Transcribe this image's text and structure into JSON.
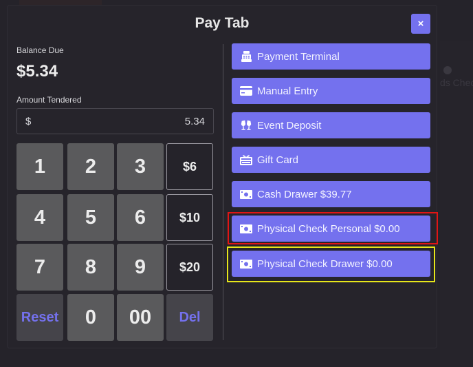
{
  "modal": {
    "title": "Pay Tab",
    "close_label": "×"
  },
  "balance": {
    "label": "Balance Due",
    "value": "$5.34"
  },
  "tendered": {
    "label": "Amount Tendered",
    "currency_symbol": "$",
    "value": "5.34"
  },
  "keypad": {
    "keys": [
      "1",
      "2",
      "3",
      "4",
      "5",
      "6",
      "7",
      "8",
      "9",
      "0",
      "00"
    ],
    "quick_amounts": [
      "$6",
      "$10",
      "$20"
    ],
    "reset_label": "Reset",
    "delete_label": "Del"
  },
  "payment_methods": [
    {
      "label": "Payment Terminal",
      "icon": "cash-register-icon"
    },
    {
      "label": "Manual Entry",
      "icon": "credit-card-icon"
    },
    {
      "label": "Event Deposit",
      "icon": "glass-cheers-icon"
    },
    {
      "label": "Gift Card",
      "icon": "gift-card-icon"
    },
    {
      "label": "Cash Drawer $39.77",
      "icon": "money-bill-icon"
    },
    {
      "label": "Physical Check Personal $0.00",
      "icon": "money-bill-icon",
      "highlight": "red"
    },
    {
      "label": "Physical Check Drawer $0.00",
      "icon": "money-bill-icon",
      "highlight": "yellow"
    }
  ],
  "background": {
    "ghost_text": "ds Check"
  },
  "colors": {
    "accent": "#7471ee",
    "highlight_red": "#e01515",
    "highlight_yellow": "#e6e61a"
  }
}
